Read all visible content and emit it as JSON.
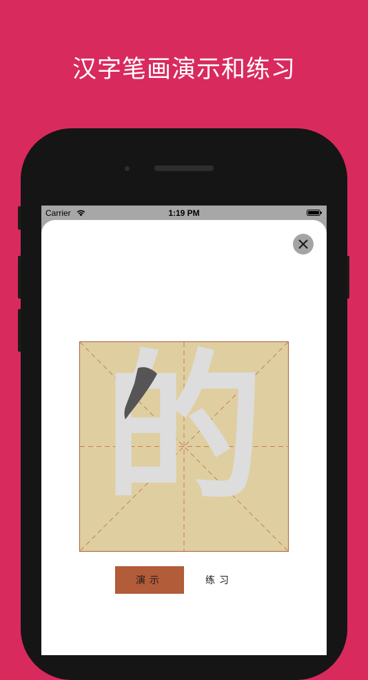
{
  "promo": {
    "headline": "汉字笔画演示和练习"
  },
  "status_bar": {
    "carrier": "Carrier",
    "time": "1:19 PM",
    "wifi_icon": "wifi-icon",
    "battery_icon": "battery-full-icon"
  },
  "sheet": {
    "close_icon": "close-icon",
    "character": "的",
    "highlighted_stroke": 1,
    "buttons": {
      "demo": "演示",
      "practice": "练习"
    }
  },
  "colors": {
    "background": "#D92A5E",
    "grid_fill": "#DFCEA0",
    "grid_border": "#B25C3A",
    "character_fill": "#DDDDDD",
    "stroke_highlight": "#555555",
    "demo_button": "#B25C3A"
  }
}
